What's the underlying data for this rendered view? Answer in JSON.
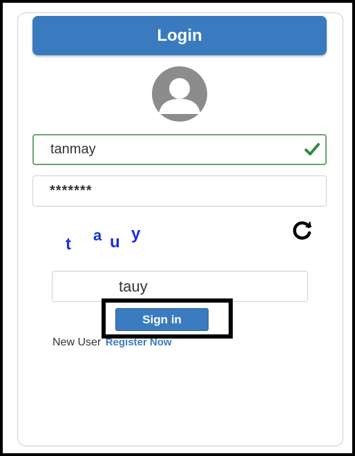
{
  "header": {
    "title": "Login"
  },
  "username": {
    "value": "tanmay"
  },
  "password": {
    "value": "*******"
  },
  "captcha": {
    "chars": [
      "t",
      "a",
      "u",
      "y"
    ]
  },
  "captcha_input": {
    "value": "tauy"
  },
  "signin": {
    "label": "Sign in"
  },
  "footer": {
    "new_user_label": "New User",
    "register_label": "Register Now"
  },
  "colors": {
    "primary": "#3a7bbf",
    "captcha_text": "#1a2fd6",
    "valid_border": "#6aa56a",
    "check": "#2e8b3c"
  }
}
